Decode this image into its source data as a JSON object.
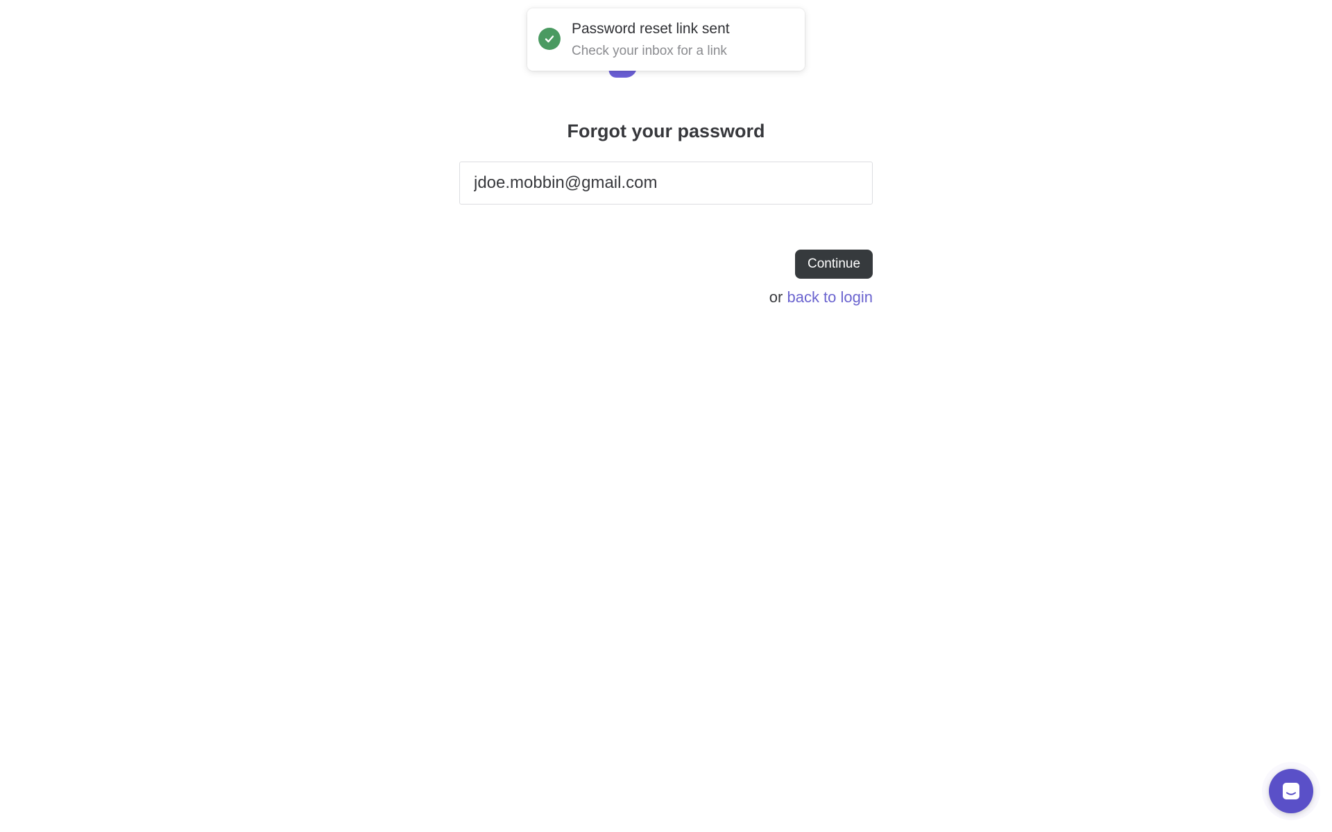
{
  "toast": {
    "title": "Password reset link sent",
    "subtitle": "Check your inbox for a link",
    "icon": "check-circle-icon",
    "color": "#4a9a61"
  },
  "form": {
    "heading": "Forgot your password",
    "email_value": "jdoe.mobbin@gmail.com",
    "continue_label": "Continue",
    "back_prefix": "or",
    "back_link_label": "back to login"
  },
  "chat": {
    "icon": "chat-icon"
  },
  "colors": {
    "accent": "#6a63cf",
    "button": "#363a3d",
    "success": "#4a9a61",
    "chat": "#5a50c8"
  }
}
